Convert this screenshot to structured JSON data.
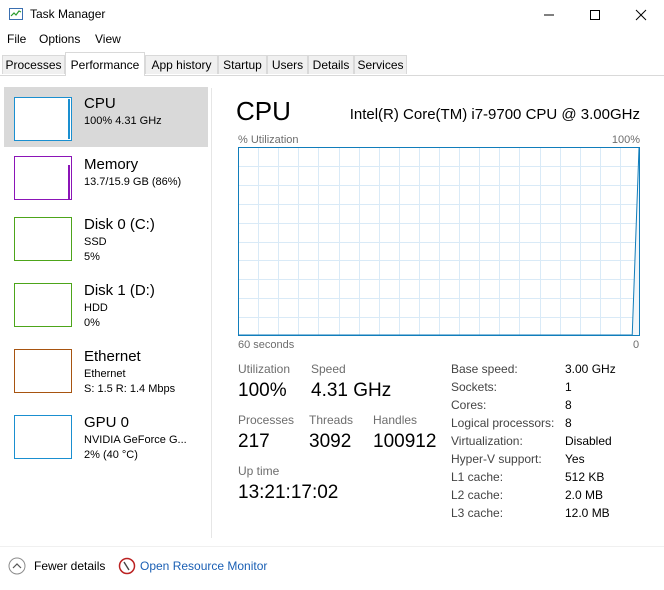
{
  "window": {
    "title": "Task Manager",
    "buttons": [
      "minimize",
      "maximize",
      "close"
    ]
  },
  "menu": [
    "File",
    "Options",
    "View"
  ],
  "tabs": [
    "Processes",
    "Performance",
    "App history",
    "Startup",
    "Users",
    "Details",
    "Services"
  ],
  "active_tab": "Performance",
  "sidebar": [
    {
      "name": "CPU",
      "line1": "100%  4.31 GHz",
      "line2": "",
      "line3": "",
      "color": "#1a8fd0"
    },
    {
      "name": "Memory",
      "line1": "13.7/15.9 GB (86%)",
      "line2": "",
      "line3": "",
      "color": "#8b14b7"
    },
    {
      "name": "Disk 0 (C:)",
      "line1": "SSD",
      "line2": "5%",
      "line3": "",
      "color": "#4da51a"
    },
    {
      "name": "Disk 1 (D:)",
      "line1": "HDD",
      "line2": "0%",
      "line3": "",
      "color": "#4da51a"
    },
    {
      "name": "Ethernet",
      "line1": "Ethernet",
      "line2": "S: 1.5  R: 1.4 Mbps",
      "line3": "",
      "color": "#a75410"
    },
    {
      "name": "GPU 0",
      "line1": "NVIDIA GeForce G...",
      "line2": "2%  (40 °C)",
      "line3": "",
      "color": "#1a8fd0"
    }
  ],
  "main": {
    "title": "CPU",
    "model": "Intel(R) Core(TM) i7-9700 CPU @ 3.00GHz",
    "util_label": "% Utilization",
    "util_max": "100%",
    "time_left": "60 seconds",
    "time_right": "0",
    "stats": {
      "utilization_label": "Utilization",
      "utilization": "100%",
      "speed_label": "Speed",
      "speed": "4.31 GHz",
      "processes_label": "Processes",
      "processes": "217",
      "threads_label": "Threads",
      "threads": "3092",
      "handles_label": "Handles",
      "handles": "100912",
      "uptime_label": "Up time",
      "uptime": "13:21:17:02"
    },
    "details": [
      {
        "k": "Base speed:",
        "v": "3.00 GHz"
      },
      {
        "k": "Sockets:",
        "v": "1"
      },
      {
        "k": "Cores:",
        "v": "8"
      },
      {
        "k": "Logical processors:",
        "v": "8"
      },
      {
        "k": "Virtualization:",
        "v": "Disabled"
      },
      {
        "k": "Hyper-V support:",
        "v": "Yes"
      },
      {
        "k": "L1 cache:",
        "v": "512 KB"
      },
      {
        "k": "L2 cache:",
        "v": "2.0 MB"
      },
      {
        "k": "L3 cache:",
        "v": "12.0 MB"
      }
    ],
    "graph_color": "#117dbb",
    "cpu_history": [
      0,
      0,
      0,
      0,
      0,
      0,
      0,
      0,
      0,
      0,
      0,
      0,
      0,
      0,
      0,
      0,
      0,
      0,
      0,
      0,
      0,
      0,
      0,
      0,
      0,
      0,
      0,
      0,
      0,
      0,
      0,
      0,
      0,
      0,
      0,
      0,
      0,
      0,
      0,
      0,
      0,
      0,
      0,
      0,
      0,
      0,
      0,
      0,
      0,
      0,
      0,
      0,
      0,
      0,
      0,
      0,
      0,
      0,
      0,
      100
    ]
  },
  "footer": {
    "fewer": "Fewer details",
    "resource_monitor": "Open Resource Monitor"
  }
}
